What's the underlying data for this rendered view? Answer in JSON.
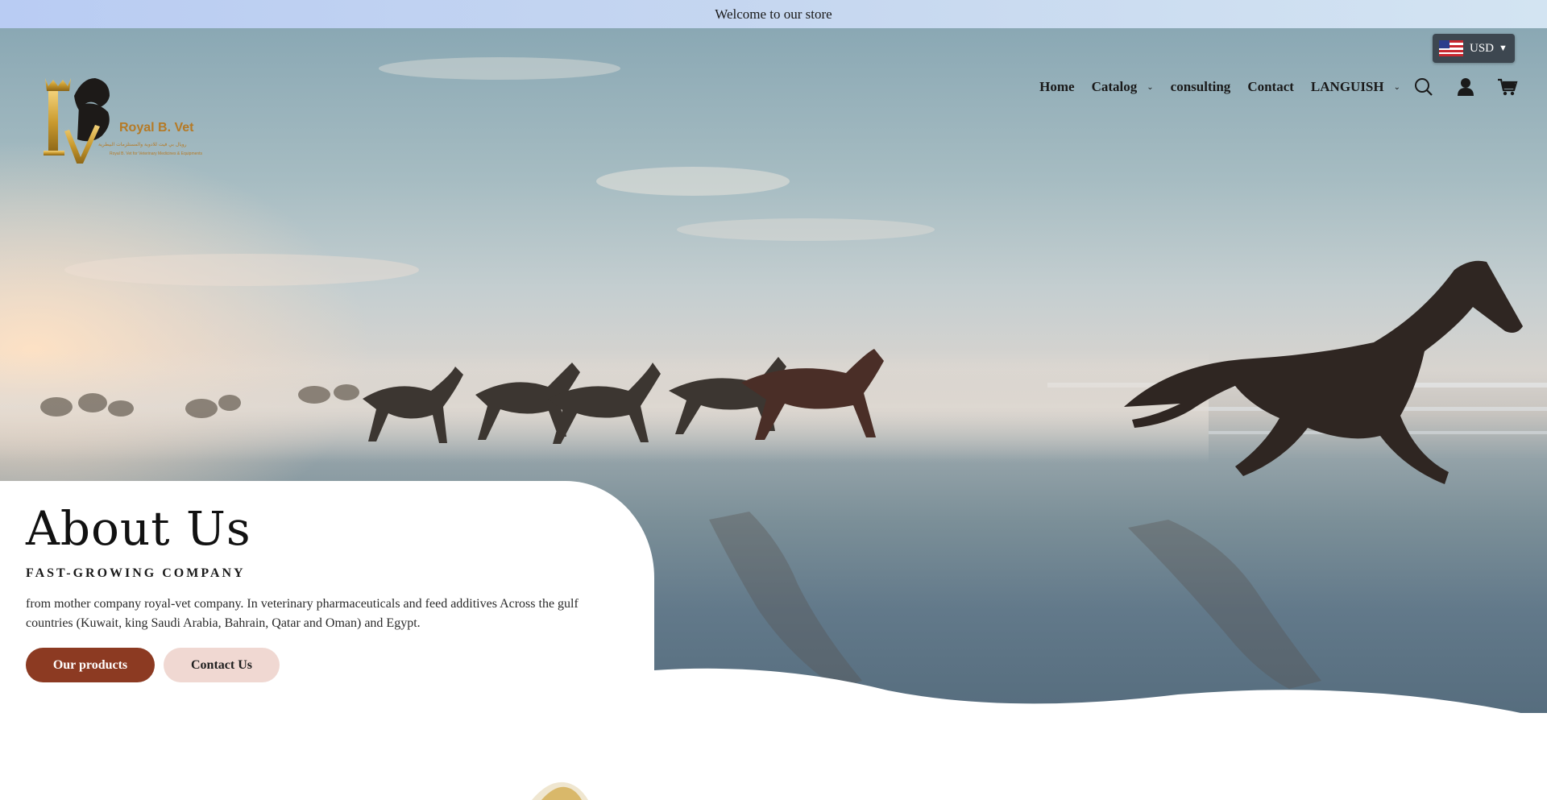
{
  "announcement": {
    "text": "Welcome to our store"
  },
  "brand": {
    "name": "Royal B. Vet",
    "arabic_tagline": "رويال بي فيت للادوية والمستلزمات البيطرية",
    "english_tagline": "Royal B. Vet for Veterinary Medicines & Equipments"
  },
  "currency": {
    "code": "USD",
    "flag_icon": "us-flag-icon"
  },
  "nav": {
    "home": "Home",
    "catalog": "Catalog",
    "consulting": "consulting",
    "contact": "Contact",
    "language": "LANGUISH"
  },
  "header_icons": [
    "search-icon",
    "account-icon",
    "cart-icon"
  ],
  "hero": {
    "title": "About Us",
    "subtitle": "FAST-GROWING COMPANY",
    "description": "from mother company royal-vet company. In veterinary pharmaceuticals and feed additives Across the gulf countries (Kuwait, king Saudi Arabia, Bahrain, Qatar and Oman) and Egypt.",
    "primary_button": "Our products",
    "secondary_button": "Contact Us"
  },
  "colors": {
    "accent": "#8c3a22",
    "secondary_button_bg": "#f0d8d2",
    "announcement_bg": "#c7d8f0",
    "logo_gold": "#c99a2e"
  }
}
